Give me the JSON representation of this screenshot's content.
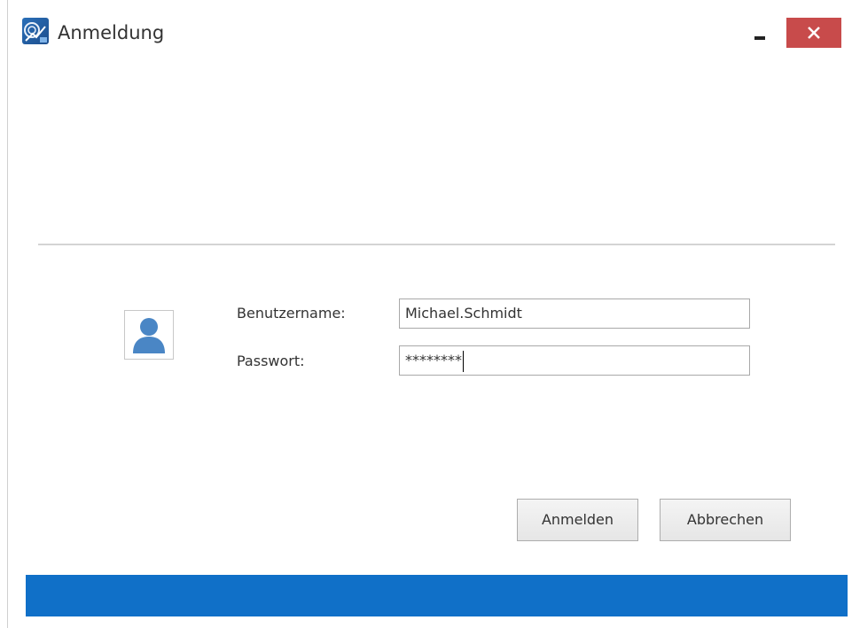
{
  "window": {
    "title": "Anmeldung"
  },
  "form": {
    "username_label": "Benutzername:",
    "username_value": "Michael.Schmidt",
    "password_label": "Passwort:",
    "password_value": "********"
  },
  "buttons": {
    "login_label": "Anmelden",
    "cancel_label": "Abbrechen"
  },
  "icons": {
    "app": "app-icon",
    "minimize": "minimize-icon",
    "close": "close-icon",
    "user": "user-avatar-icon"
  },
  "colors": {
    "close_button": "#c84b4b",
    "statusbar": "#1070c8",
    "avatar": "#4a86c5"
  }
}
